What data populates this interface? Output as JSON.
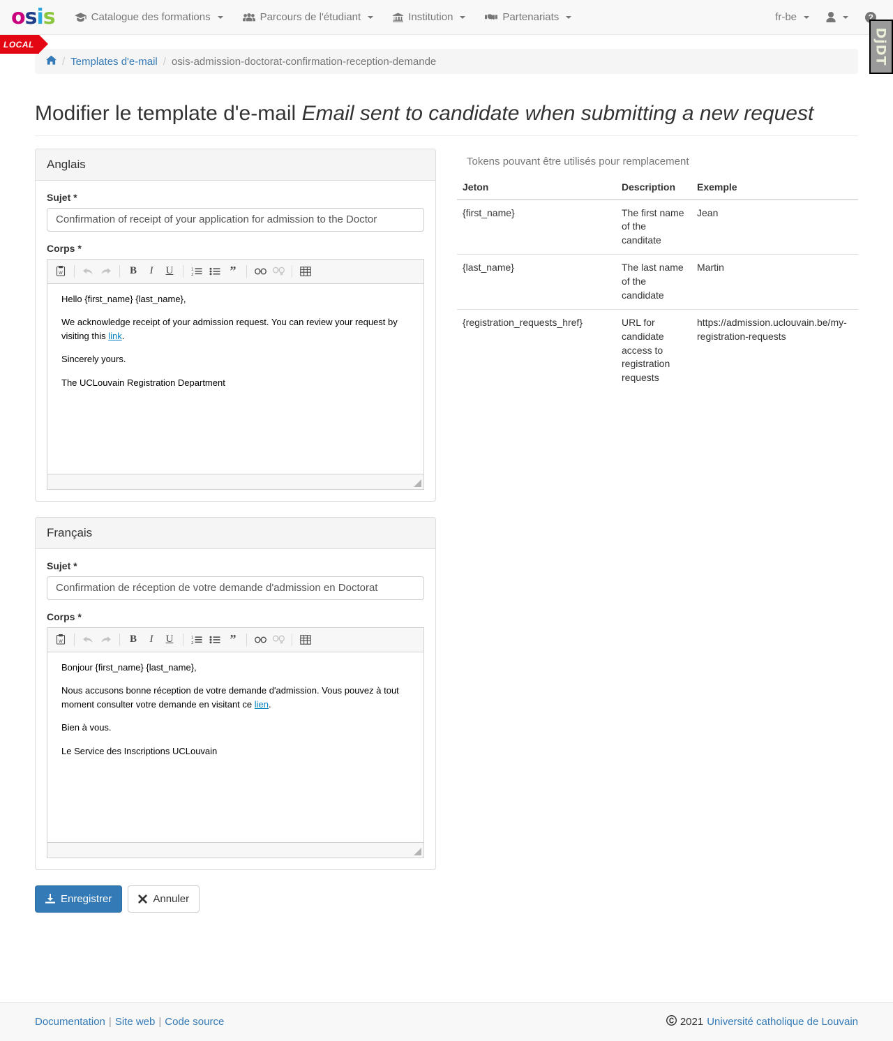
{
  "navbar": {
    "brand": {
      "name": "osis-logo",
      "letters": [
        "o",
        "s",
        "i",
        "s"
      ]
    },
    "items": [
      {
        "label": "Catalogue des formations",
        "icon": "graduation-cap-icon",
        "caret": true
      },
      {
        "label": "Parcours de l'étudiant",
        "icon": "users-icon",
        "caret": true
      },
      {
        "label": "Institution",
        "icon": "bank-icon",
        "caret": true
      },
      {
        "label": "Partenariats",
        "icon": "handshake-icon",
        "caret": true
      }
    ],
    "right": {
      "language": "fr-be",
      "user_icon": "user-icon",
      "help_icon": "question-circle-icon"
    }
  },
  "ribbon": {
    "label": "LOCAL",
    "color": "#e30613"
  },
  "debug_toolbar": {
    "label": "DjDT"
  },
  "breadcrumb": {
    "home_icon": "home-icon",
    "items": [
      {
        "label": "Templates d'e-mail",
        "link": true
      },
      {
        "label": "osis-admission-doctorat-confirmation-reception-demande",
        "link": false
      }
    ]
  },
  "page": {
    "title_prefix": "Modifier le template d'e-mail",
    "title_emphasis": "Email sent to candidate when submitting a new request"
  },
  "editor_toolbar": {
    "buttons": [
      {
        "name": "paste-from-word-icon",
        "glyph": "clipboard",
        "disabled": false
      },
      {
        "name": "undo-icon",
        "glyph": "undo",
        "disabled": true
      },
      {
        "name": "redo-icon",
        "glyph": "redo",
        "disabled": true
      },
      {
        "name": "bold-icon",
        "glyph": "B",
        "disabled": false
      },
      {
        "name": "italic-icon",
        "glyph": "I",
        "disabled": false
      },
      {
        "name": "underline-icon",
        "glyph": "U",
        "disabled": false
      },
      {
        "name": "numbered-list-icon",
        "glyph": "ol",
        "disabled": false
      },
      {
        "name": "bulleted-list-icon",
        "glyph": "ul",
        "disabled": false
      },
      {
        "name": "blockquote-icon",
        "glyph": "”",
        "disabled": false
      },
      {
        "name": "link-icon",
        "glyph": "link",
        "disabled": false
      },
      {
        "name": "unlink-icon",
        "glyph": "unlink",
        "disabled": true
      },
      {
        "name": "table-icon",
        "glyph": "table",
        "disabled": false
      }
    ]
  },
  "panels": {
    "english": {
      "heading": "Anglais",
      "subject_label": "Sujet *",
      "subject_value": "Confirmation of receipt of your application for admission to the Doctor",
      "body_label": "Corps *",
      "body": {
        "greeting": "Hello {first_name} {last_name},",
        "paragraph_pre": "We acknowledge receipt of your admission request. You can review your request by visiting this ",
        "paragraph_link": "link",
        "paragraph_post": ".",
        "closing": "Sincerely yours.",
        "signature": "The UCLouvain Registration Department"
      }
    },
    "french": {
      "heading": "Français",
      "subject_label": "Sujet *",
      "subject_value": "Confirmation de réception de votre demande d'admission en Doctorat",
      "body_label": "Corps *",
      "body": {
        "greeting": "Bonjour {first_name} {last_name},",
        "paragraph_pre": "Nous accusons bonne réception de votre demande d'admission. Vous pouvez à tout moment consulter votre demande en visitant ce ",
        "paragraph_link": "lien",
        "paragraph_post": ".",
        "closing": "Bien à vous.",
        "signature": "Le Service des Inscriptions UCLouvain"
      }
    }
  },
  "tokens": {
    "caption": "Tokens pouvant être utilisés pour remplacement",
    "columns": [
      "Jeton",
      "Description",
      "Exemple"
    ],
    "rows": [
      {
        "jeton": "{first_name}",
        "description": "The first name of the canditate",
        "exemple": "Jean"
      },
      {
        "jeton": "{last_name}",
        "description": "The last name of the candidate",
        "exemple": "Martin"
      },
      {
        "jeton": "{registration_requests_href}",
        "description": "URL for candidate access to registration requests",
        "exemple": "https://admission.uclouvain.be/my-registration-requests"
      }
    ]
  },
  "actions": {
    "save_label": "Enregistrer",
    "save_icon": "download-icon",
    "cancel_label": "Annuler",
    "cancel_icon": "times-icon"
  },
  "footer": {
    "links": [
      "Documentation",
      "Site web",
      "Code source"
    ],
    "copyright_icon": "copyright-icon",
    "year": "2021",
    "organization": "Université catholique de Louvain"
  }
}
